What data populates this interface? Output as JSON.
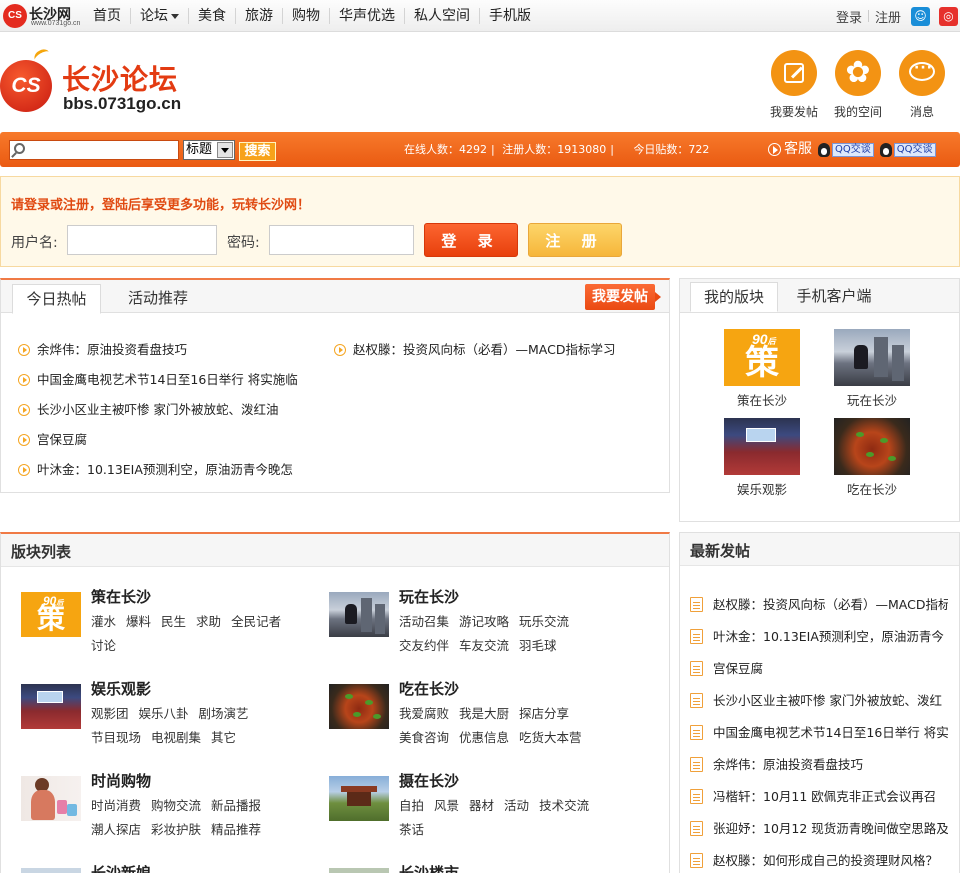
{
  "topnav": {
    "site_name": "长沙网",
    "site_url": "www.0731go.cn",
    "items": [
      "首页",
      "论坛",
      "美食",
      "旅游",
      "购物",
      "华声优选",
      "私人空间",
      "手机版"
    ],
    "login": "登录",
    "register": "注册"
  },
  "header": {
    "logo_badge": "CS",
    "title": "长沙论坛",
    "url": "bbs.0731go.cn",
    "icons": [
      {
        "label": "我要发帖",
        "icon": "pen-icon"
      },
      {
        "label": "我的空间",
        "icon": "flower-icon"
      },
      {
        "label": "消息",
        "icon": "chat-icon"
      }
    ]
  },
  "search": {
    "placeholder": "",
    "scope": "标题",
    "button": "搜索",
    "online": "在线人数：4292",
    "registered": "注册人数：1913080",
    "today": "今日贴数：722",
    "service": "客服",
    "qq1": "QQ交谈",
    "qq2": "QQ交谈"
  },
  "login_panel": {
    "tip": "请登录或注册，登陆后享受更多功能，玩转长沙网！",
    "username_label": "用户名:",
    "password_label": "密码:",
    "login_button": "登 录",
    "register_button": "注 册"
  },
  "hot": {
    "tabs": [
      "今日热帖",
      "活动推荐"
    ],
    "post_button": "我要发帖",
    "left": [
      "余烨伟：原油投资看盘技巧",
      "中国金鹰电视艺术节14日至16日举行 将实施临",
      "长沙小区业主被吓惨 家门外被放蛇、泼红油",
      "宫保豆腐",
      "叶沐金：10.13EIA预测利空，原油沥青今晚怎"
    ],
    "right": [
      "赵权滕：投资风向标（必看）—MACD指标学习"
    ]
  },
  "my_boards": {
    "tabs": [
      "我的版块",
      "手机客户端"
    ],
    "items": [
      "策在长沙",
      "玩在长沙",
      "娱乐观影",
      "吃在长沙"
    ]
  },
  "board_list": {
    "title": "版块列表",
    "boards": [
      {
        "name": "策在长沙",
        "subs": [
          "灌水",
          "爆料",
          "民生",
          "求助",
          "全民记者",
          "讨论"
        ]
      },
      {
        "name": "玩在长沙",
        "subs": [
          "活动召集",
          "游记攻略",
          "玩乐交流",
          "交友约伴",
          "车友交流",
          "羽毛球"
        ]
      },
      {
        "name": "娱乐观影",
        "subs": [
          "观影团",
          "娱乐八卦",
          "剧场演艺",
          "节目现场",
          "电视剧集",
          "其它"
        ]
      },
      {
        "name": "吃在长沙",
        "subs": [
          "我爱腐败",
          "我是大厨",
          "探店分享",
          "美食咨询",
          "优惠信息",
          "吃货大本营"
        ]
      },
      {
        "name": "时尚购物",
        "subs": [
          "时尚消费",
          "购物交流",
          "新品播报",
          "潮人探店",
          "彩妆护肤",
          "精品推荐"
        ]
      },
      {
        "name": "摄在长沙",
        "subs": [
          "自拍",
          "风景",
          "器材",
          "活动",
          "技术交流",
          "茶话"
        ]
      },
      {
        "name": "长沙新娘",
        "subs": []
      },
      {
        "name": "长沙楼市",
        "subs": []
      }
    ]
  },
  "latest": {
    "title": "最新发帖",
    "items": [
      "赵权滕：投资风向标（必看）—MACD指标",
      "叶沐金：10.13EIA预测利空，原油沥青今",
      "宫保豆腐",
      "长沙小区业主被吓惨 家门外被放蛇、泼红",
      "中国金鹰电视艺术节14日至16日举行 将实",
      "余烨伟：原油投资看盘技巧",
      "冯楷轩：10月11 欧佩克非正式会议再召",
      "张迎妤：10月12 现货沥青晚间做空思路及",
      "赵权滕：如何形成自己的投资理财风格？"
    ]
  }
}
